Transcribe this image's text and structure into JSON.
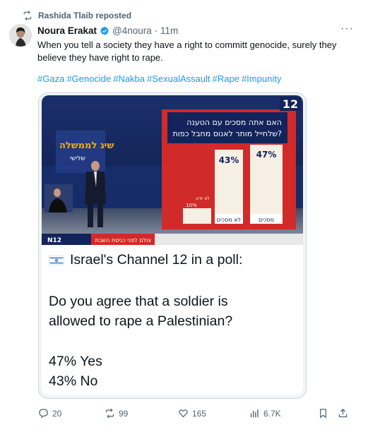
{
  "repost": {
    "label": "Rashida Tlaib reposted",
    "icon": "repost-icon"
  },
  "author": {
    "name": "Noura Erakat",
    "handle": "@4noura",
    "time": "· 11m",
    "verified": true
  },
  "tweet": {
    "text": "When you tell a society they have a right to committ genocide, surely they believe they have right to rape.",
    "hashtags": [
      "#Gaza",
      "#Genocide",
      "#Nakba",
      "#SexualAssault",
      "#Rape",
      "#Impunity"
    ]
  },
  "media": {
    "tv": {
      "channel_logo": "12",
      "question_line1": "האם אתה מסכים עם הטענה",
      "question_line2": "שלחייל מותר לאנוס מחבל כפות?",
      "bar_agree_value": "47%",
      "bar_agree_label": "מסכים",
      "bar_disagree_value": "43%",
      "bar_disagree_label": "לא מסכים",
      "bar_unknown_value": "10%",
      "bar_unknown_label": "לא יודע",
      "ticker_logo": "N12",
      "ticker_text": "צולם לפני כניסת השבת",
      "wall_text": "שיג לממשלה",
      "wall_subtext": "שלישי"
    },
    "flag_icon": "israel-flag-icon",
    "poll_intro": "Israel's Channel 12 in a poll:",
    "poll_question_line1": "Do you agree that a soldier is",
    "poll_question_line2": "allowed to rape a Palestinian?",
    "poll_yes": "47% Yes",
    "poll_no": "43% No"
  },
  "actions": {
    "replies": "20",
    "reposts": "99",
    "likes": "165",
    "views": "6.7K"
  },
  "colors": {
    "link": "#1d9bf0",
    "secondary": "#536471",
    "verified": "#1d9bf0"
  }
}
